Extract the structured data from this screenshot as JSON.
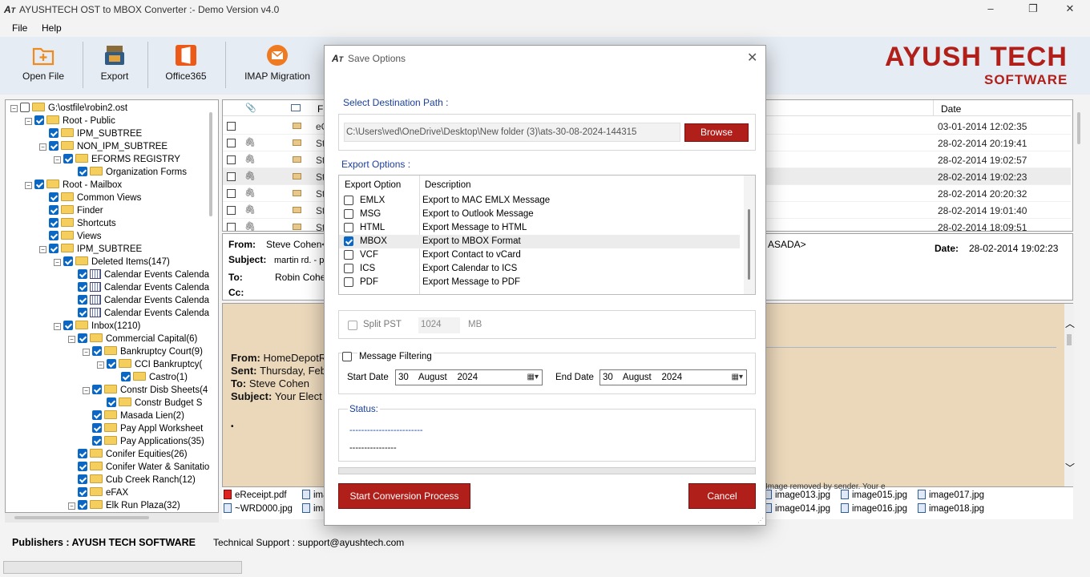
{
  "window": {
    "title": "AYUSHTECH OST to MBOX Converter :- Demo Version v4.0",
    "controls": [
      "–",
      "❐",
      "✕"
    ]
  },
  "menu": [
    "File",
    "Help"
  ],
  "toolbar": {
    "open": "Open File",
    "export": "Export",
    "o365": "Office365",
    "imap": "IMAP Migration"
  },
  "brand": {
    "name": "AYUSH TECH",
    "sub": "SOFTWARE",
    "color": "#b01f1a"
  },
  "tree": [
    {
      "label": "G:\\ostfile\\robin2.ost",
      "depth": 0,
      "checked": false,
      "icon": "folder",
      "exp": true
    },
    {
      "label": "Root - Public",
      "depth": 1,
      "checked": true,
      "icon": "folder",
      "exp": true
    },
    {
      "label": "IPM_SUBTREE",
      "depth": 2,
      "checked": true,
      "icon": "folder"
    },
    {
      "label": "NON_IPM_SUBTREE",
      "depth": 2,
      "checked": true,
      "icon": "folder",
      "exp": true
    },
    {
      "label": "EFORMS REGISTRY",
      "depth": 3,
      "checked": true,
      "icon": "folder",
      "exp": true
    },
    {
      "label": "Organization Forms",
      "depth": 4,
      "checked": true,
      "icon": "folder"
    },
    {
      "label": "Root - Mailbox",
      "depth": 1,
      "checked": true,
      "icon": "folder",
      "exp": true
    },
    {
      "label": "Common Views",
      "depth": 2,
      "checked": true,
      "icon": "folder"
    },
    {
      "label": "Finder",
      "depth": 2,
      "checked": true,
      "icon": "folder"
    },
    {
      "label": "Shortcuts",
      "depth": 2,
      "checked": true,
      "icon": "folder"
    },
    {
      "label": "Views",
      "depth": 2,
      "checked": true,
      "icon": "folder"
    },
    {
      "label": "IPM_SUBTREE",
      "depth": 2,
      "checked": true,
      "icon": "folder",
      "exp": true
    },
    {
      "label": "Deleted Items(147)",
      "depth": 3,
      "checked": true,
      "icon": "folder",
      "exp": true
    },
    {
      "label": "Calendar Events Calenda",
      "depth": 4,
      "checked": true,
      "icon": "calendar"
    },
    {
      "label": "Calendar Events Calenda",
      "depth": 4,
      "checked": true,
      "icon": "calendar"
    },
    {
      "label": "Calendar Events Calenda",
      "depth": 4,
      "checked": true,
      "icon": "calendar"
    },
    {
      "label": "Calendar Events Calenda",
      "depth": 4,
      "checked": true,
      "icon": "calendar"
    },
    {
      "label": "Inbox(1210)",
      "depth": 3,
      "checked": true,
      "icon": "folder",
      "exp": true
    },
    {
      "label": "Commercial Capital(6)",
      "depth": 4,
      "checked": true,
      "icon": "folder",
      "exp": true
    },
    {
      "label": "Bankruptcy Court(9)",
      "depth": 5,
      "checked": true,
      "icon": "folder",
      "exp": true
    },
    {
      "label": "CCI Bankruptcy(",
      "depth": 6,
      "checked": true,
      "icon": "folder",
      "exp": true
    },
    {
      "label": "Castro(1)",
      "depth": 7,
      "checked": true,
      "icon": "folder"
    },
    {
      "label": "Constr Disb Sheets(4",
      "depth": 5,
      "checked": true,
      "icon": "folder",
      "exp": true
    },
    {
      "label": "Constr Budget S",
      "depth": 6,
      "checked": true,
      "icon": "folder"
    },
    {
      "label": "Masada Lien(2)",
      "depth": 5,
      "checked": true,
      "icon": "folder"
    },
    {
      "label": "Pay Appl Worksheet",
      "depth": 5,
      "checked": true,
      "icon": "folder"
    },
    {
      "label": "Pay Applications(35)",
      "depth": 5,
      "checked": true,
      "icon": "folder"
    },
    {
      "label": "Conifer Equities(26)",
      "depth": 4,
      "checked": true,
      "icon": "folder"
    },
    {
      "label": "Conifer Water & Sanitatio",
      "depth": 4,
      "checked": true,
      "icon": "folder"
    },
    {
      "label": "Cub Creek Ranch(12)",
      "depth": 4,
      "checked": true,
      "icon": "folder"
    },
    {
      "label": "eFAX",
      "depth": 4,
      "checked": true,
      "icon": "folder"
    },
    {
      "label": "Elk Run Plaza(32)",
      "depth": 4,
      "checked": true,
      "icon": "folder",
      "exp": true
    }
  ],
  "list": {
    "headers": {
      "from": "Fr",
      "date": "Date"
    },
    "rows": [
      {
        "from": "eC",
        "date": "03-01-2014 12:02:35",
        "attach": false
      },
      {
        "from": "St",
        "date": "28-02-2014 20:19:41",
        "attach": true
      },
      {
        "from": "St",
        "date": "28-02-2014 19:02:57",
        "attach": true
      },
      {
        "from": "St",
        "date": "28-02-2014 19:02:23",
        "attach": true
      },
      {
        "from": "St",
        "date": "28-02-2014 20:20:32",
        "attach": true
      },
      {
        "from": "St",
        "date": "28-02-2014 19:01:40",
        "attach": true
      },
      {
        "from": "St",
        "date": "28-02-2014 18:09:51",
        "attach": true
      }
    ]
  },
  "preview": {
    "from_l": "From:",
    "from": "Steve Cohen</",
    "from_tail": "ASADA>",
    "subject_l": "Subject:",
    "subject": "martin rd. - pc",
    "to_l": "To:",
    "to": "Robin Cohen",
    "cc_l": "Cc:",
    "date_l": "Date:",
    "date": "28-02-2014 19:02:23"
  },
  "body": {
    "from": "From: ",
    "from_v": "HomeDepotRe",
    "sent": "Sent: ",
    "sent_v": "Thursday, Feb",
    "to": "To: ",
    "to_v": "Steve Cohen",
    "subj": "Subject: ",
    "subj_v": "Your Elect",
    "dot": "•"
  },
  "attachments": [
    {
      "name": "eReceipt.pdf",
      "pdf": true
    },
    {
      "name": "~WRD000.jpg"
    },
    {
      "name": "ima"
    },
    {
      "name": "ima"
    },
    {
      "name": "Image removed by sender. Your e"
    },
    {
      "name": "image013.jpg"
    },
    {
      "name": "image014.jpg"
    },
    {
      "name": "image015.jpg"
    },
    {
      "name": "image016.jpg"
    },
    {
      "name": "image017.jpg"
    },
    {
      "name": "image018.jpg"
    }
  ],
  "statusbar": {
    "publisher": "Publishers : AYUSH TECH SOFTWARE",
    "support": "Technical Support : support@ayushtech.com"
  },
  "dialog": {
    "title": "Save Options",
    "dest_label": "Select Destination Path :",
    "path": "C:\\Users\\ved\\OneDrive\\Desktop\\New folder (3)\\ats-30-08-2024-144315",
    "browse": "Browse",
    "export_label": "Export Options :",
    "col_opt": "Export Option",
    "col_desc": "Description",
    "options": [
      {
        "name": "EMLX",
        "desc": "Export to MAC EMLX Message",
        "checked": false
      },
      {
        "name": "MSG",
        "desc": "Export to Outlook Message",
        "checked": false
      },
      {
        "name": "HTML",
        "desc": "Export Message to HTML",
        "checked": false
      },
      {
        "name": "MBOX",
        "desc": "Export to MBOX Format",
        "checked": true
      },
      {
        "name": "VCF",
        "desc": "Export Contact to vCard",
        "checked": false
      },
      {
        "name": "ICS",
        "desc": "Export Calendar to ICS",
        "checked": false
      },
      {
        "name": "PDF",
        "desc": "Export Message to PDF",
        "checked": false
      }
    ],
    "split_label": "Split PST",
    "split_value": "1024",
    "split_unit": "MB",
    "filter_label": "Message Filtering",
    "start_label": "Start Date",
    "start_date": "30    August    2024",
    "end_label": "End Date",
    "end_date": "30    August    2024",
    "status_label": "Status:",
    "status_line1": "-------------------------",
    "status_line2": "----------------",
    "start_btn": "Start Conversion Process",
    "cancel_btn": "Cancel"
  }
}
